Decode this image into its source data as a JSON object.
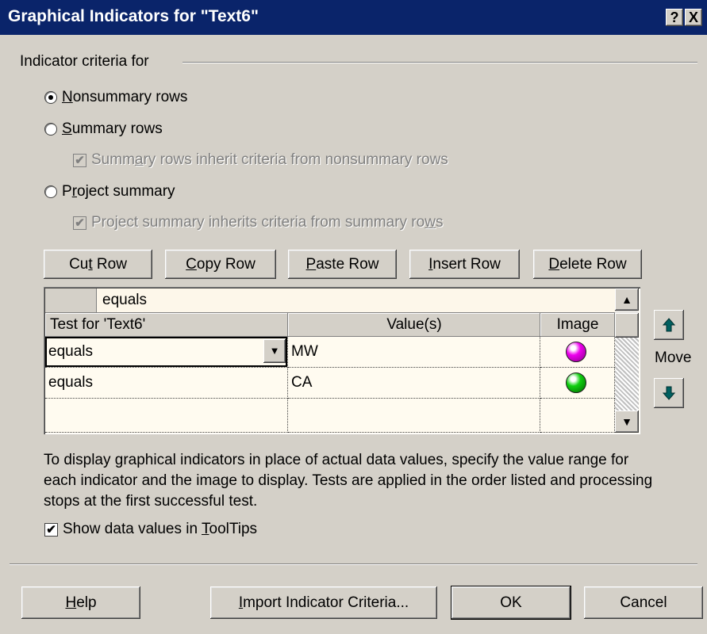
{
  "window": {
    "title": "Graphical Indicators for \"Text6\"",
    "help_btn": "?",
    "close_btn": "X"
  },
  "criteria": {
    "group_label": "Indicator criteria for",
    "options": [
      {
        "pre": "",
        "key": "N",
        "rest": "onsummary rows",
        "selected": true
      },
      {
        "pre": "",
        "key": "S",
        "rest": "ummary rows",
        "selected": false
      },
      {
        "pre": "P",
        "key": "r",
        "rest": "oject summary",
        "selected": false
      }
    ],
    "inherit_summary": {
      "pre": "Summ",
      "key": "a",
      "rest": "ry rows inherit criteria from nonsummary rows",
      "checked": true,
      "enabled": false
    },
    "inherit_project": {
      "pre": "Project summary inherits criteria from summary ro",
      "key": "w",
      "rest": "s",
      "checked": true,
      "enabled": false
    }
  },
  "row_buttons": [
    {
      "pre": "Cu",
      "key": "t",
      "rest": " Row"
    },
    {
      "pre": "",
      "key": "C",
      "rest": "opy Row"
    },
    {
      "pre": "",
      "key": "P",
      "rest": "aste Row"
    },
    {
      "pre": "",
      "key": "I",
      "rest": "nsert Row"
    },
    {
      "pre": "",
      "key": "D",
      "rest": "elete Row"
    }
  ],
  "grid": {
    "edit_value": "equals",
    "headers": {
      "test": "Test for 'Text6'",
      "values": "Value(s)",
      "image": "Image"
    },
    "rows": [
      {
        "test": "equals",
        "value": "MW",
        "image_color": "#ee00ee",
        "image_name": "magenta-ball-icon"
      },
      {
        "test": "equals",
        "value": "CA",
        "image_color": "#10d010",
        "image_name": "green-ball-icon"
      },
      {
        "test": "",
        "value": "",
        "image_color": "",
        "image_name": ""
      }
    ]
  },
  "move": {
    "label": "Move"
  },
  "description": "To display graphical indicators in place of actual data values, specify the value range for each indicator and the image to display.  Tests are applied in the order listed and processing stops at the first successful test.",
  "tooltips": {
    "pre": "Show data values in ",
    "key": "T",
    "rest": "oolTips",
    "checked": true
  },
  "footer": {
    "help": {
      "pre": "",
      "key": "H",
      "rest": "elp"
    },
    "import": {
      "pre": "",
      "key": "I",
      "rest": "mport Indicator Criteria..."
    },
    "ok": "OK",
    "cancel": "Cancel"
  }
}
